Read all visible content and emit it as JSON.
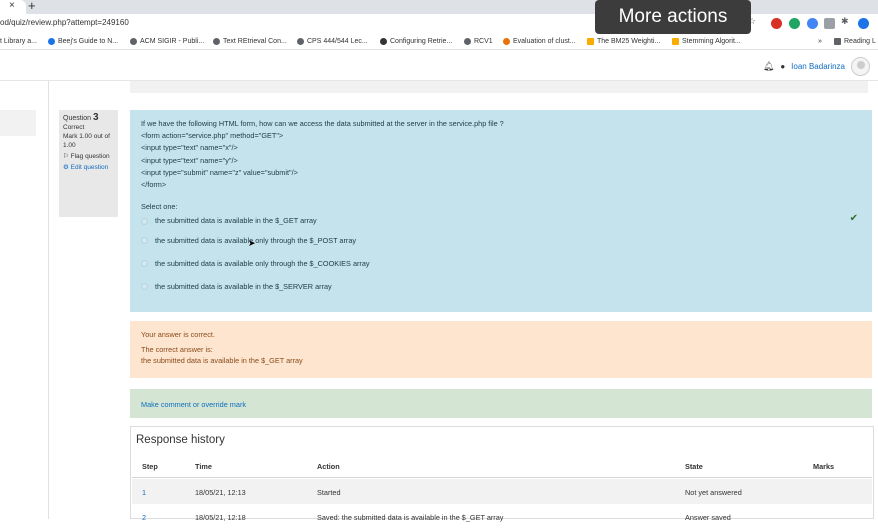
{
  "browser": {
    "tab_close": "×",
    "new_tab": "+",
    "url_prefix": "od/quiz/review.php?attempt=249160",
    "tooltip": "More actions",
    "bookmarks": [
      "t Library a...",
      "Beej's Guide to N...",
      "ACM SIGIR - Publi...",
      "Text REtrieval Con...",
      "CPS 444/544 Lec...",
      "Configuring Retrie...",
      "RCV1",
      "Evaluation of clust...",
      "The BM25 Weighti...",
      "Stemming Algorit...",
      "»",
      "Reading L"
    ]
  },
  "navbar": {
    "user_name": "Ioan Badarinza"
  },
  "question": {
    "label": "Question ",
    "number": "3",
    "status": "Correct",
    "mark": "Mark 1.00 out of 1.00",
    "flag": "Flag question",
    "edit": "Edit question",
    "text_lines": [
      "If we have the following HTML form, how can we access the data submitted at the server in the service.php file ?",
      "<form action=\"service.php\" method=\"GET\">",
      "<input type=\"text\" name=\"x\"/>",
      "<input type=\"text\" name=\"y\"/>",
      "<input type=\"submit\" name=\"z\" value=\"submit\"/>",
      "</form>"
    ],
    "select_label": "Select one:",
    "options": [
      "the submitted data is available in the $_GET array",
      "the submitted data is available only through the $_POST array",
      "the submitted data is available only through the $_COOKIES array",
      "the submitted data is available in the $_SERVER array"
    ]
  },
  "feedback": {
    "line1": "Your answer is correct.",
    "line2": "The correct answer is:",
    "line3": "the submitted data is available in the $_GET array"
  },
  "comment_link": "Make comment or override mark",
  "history": {
    "title": "Response history",
    "headers": [
      "Step",
      "Time",
      "Action",
      "State",
      "Marks"
    ],
    "rows": [
      [
        "1",
        "18/05/21, 12:13",
        "Started",
        "Not yet answered",
        ""
      ],
      [
        "2",
        "18/05/21, 12:18",
        "Saved: the submitted data is available in the $_GET array",
        "Answer saved",
        ""
      ]
    ]
  },
  "colors": {
    "question_bg": "#c5e3ec",
    "feedback_bg": "#fde5cf",
    "comment_bg": "#d4e6d3",
    "link": "#0f6cbf"
  }
}
